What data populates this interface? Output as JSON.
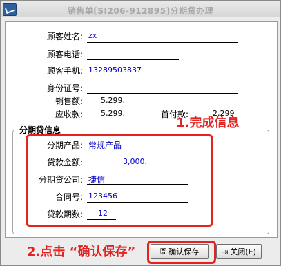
{
  "window": {
    "title": "销售单[SI206-912895]分期贷办理"
  },
  "customer": {
    "name_label": "顾客姓名:",
    "name_value": "zx",
    "phone_label": "顾客电话:",
    "phone_value": "",
    "mobile_label": "顾客手机:",
    "mobile_value": "13289503837",
    "id_label": "身份证号:",
    "id_value": "",
    "sales_label": "销售额:",
    "sales_value": "5,299.",
    "receivable_label": "应收款:",
    "receivable_value": "5,299.",
    "down_label": "首付款:",
    "down_value": "2,299"
  },
  "installment": {
    "group_title": "分期贷信息",
    "product_label": "分期产品:",
    "product_value": "常规产品",
    "amount_label": "贷款金额:",
    "amount_value": "3,000.",
    "company_label": "分期贷公司:",
    "company_value": "捷信",
    "contract_label": "合同号:",
    "contract_value": "123456",
    "periods_label": "贷款期数:",
    "periods_value": "12"
  },
  "annotations": {
    "step1": "1.完成信息",
    "step2": "2.点击  “确认保存”"
  },
  "buttons": {
    "confirm_label": "确认保存",
    "close_label": "关闭(E)"
  },
  "colors": {
    "highlight": "#e32222",
    "value_text": "#0000c8"
  }
}
